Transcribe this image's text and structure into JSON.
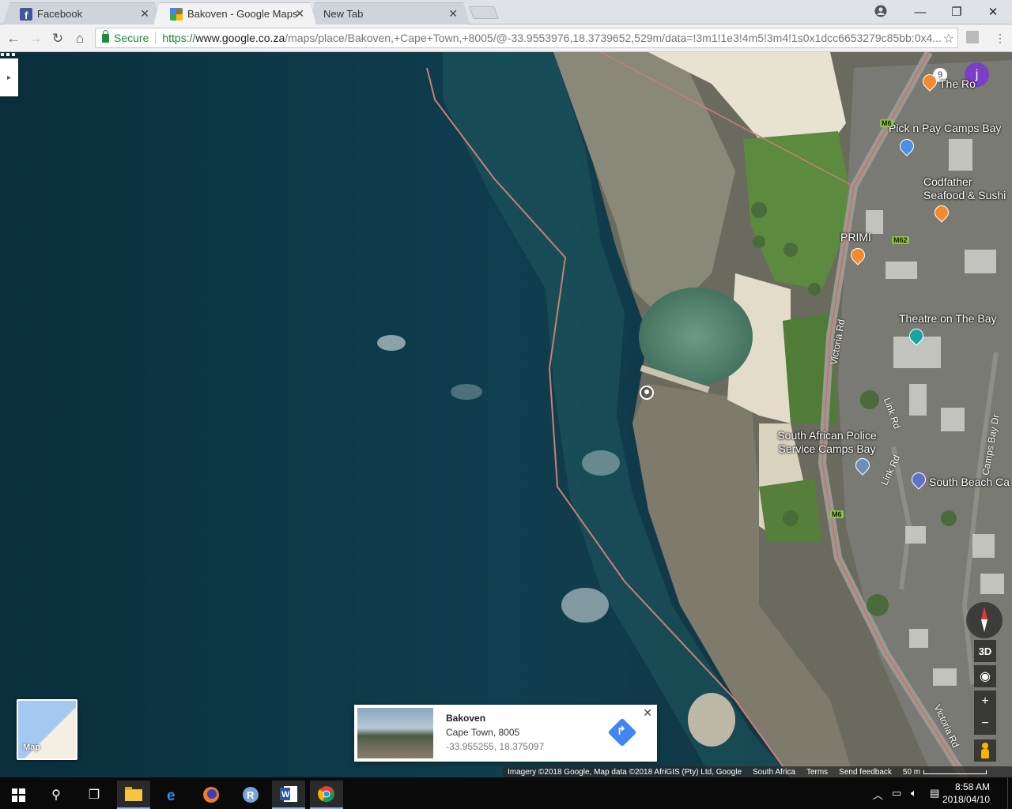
{
  "browser": {
    "tabs": [
      {
        "label": "Facebook",
        "active": false
      },
      {
        "label": "Bakoven - Google Maps",
        "active": true
      },
      {
        "label": "New Tab",
        "active": false
      }
    ],
    "secure_label": "Secure",
    "url_scheme": "https://",
    "url_host": "www.google.co.za",
    "url_path": "/maps/place/Bakoven,+Cape+Town,+8005/@-33.9553976,18.3739652,529m/data=!3m1!1e3!4m5!3m4!1s0x1dcc6653279c85bb:0x4..."
  },
  "map": {
    "avatar_letter": "j",
    "notification_count": "9",
    "places": [
      {
        "name": "The Ro"
      },
      {
        "name": "Pick n Pay Camps Bay"
      },
      {
        "name": "Codfather Seafood & Sushi"
      },
      {
        "name": "PRIMI"
      },
      {
        "name": "Theatre on The Bay"
      },
      {
        "name": "South African Police Service Camps Bay"
      },
      {
        "name": "South Beach Ca"
      }
    ],
    "roads": [
      {
        "name": "Victoria Rd"
      },
      {
        "name": "Link Rd"
      },
      {
        "name": "Link Rd"
      },
      {
        "name": "Camps Bay Dr"
      },
      {
        "name": "Victoria Rd"
      }
    ],
    "route_badges": [
      "M6",
      "M62",
      "M6"
    ],
    "minimap_label": "Map",
    "controls": {
      "three_d": "3D",
      "zoom_in": "+",
      "zoom_out": "−"
    },
    "info_card": {
      "title": "Bakoven",
      "address": "Cape Town, 8005",
      "coords": "-33.955255, 18.375097"
    },
    "footer": {
      "attribution": "Imagery ©2018 Google, Map data ©2018 AfriGIS (Pty) Ltd, Google",
      "region": "South Africa",
      "terms": "Terms",
      "feedback": "Send feedback",
      "scale": "50 m"
    }
  },
  "taskbar": {
    "time": "8:58 AM",
    "date": "2018/04/10"
  }
}
